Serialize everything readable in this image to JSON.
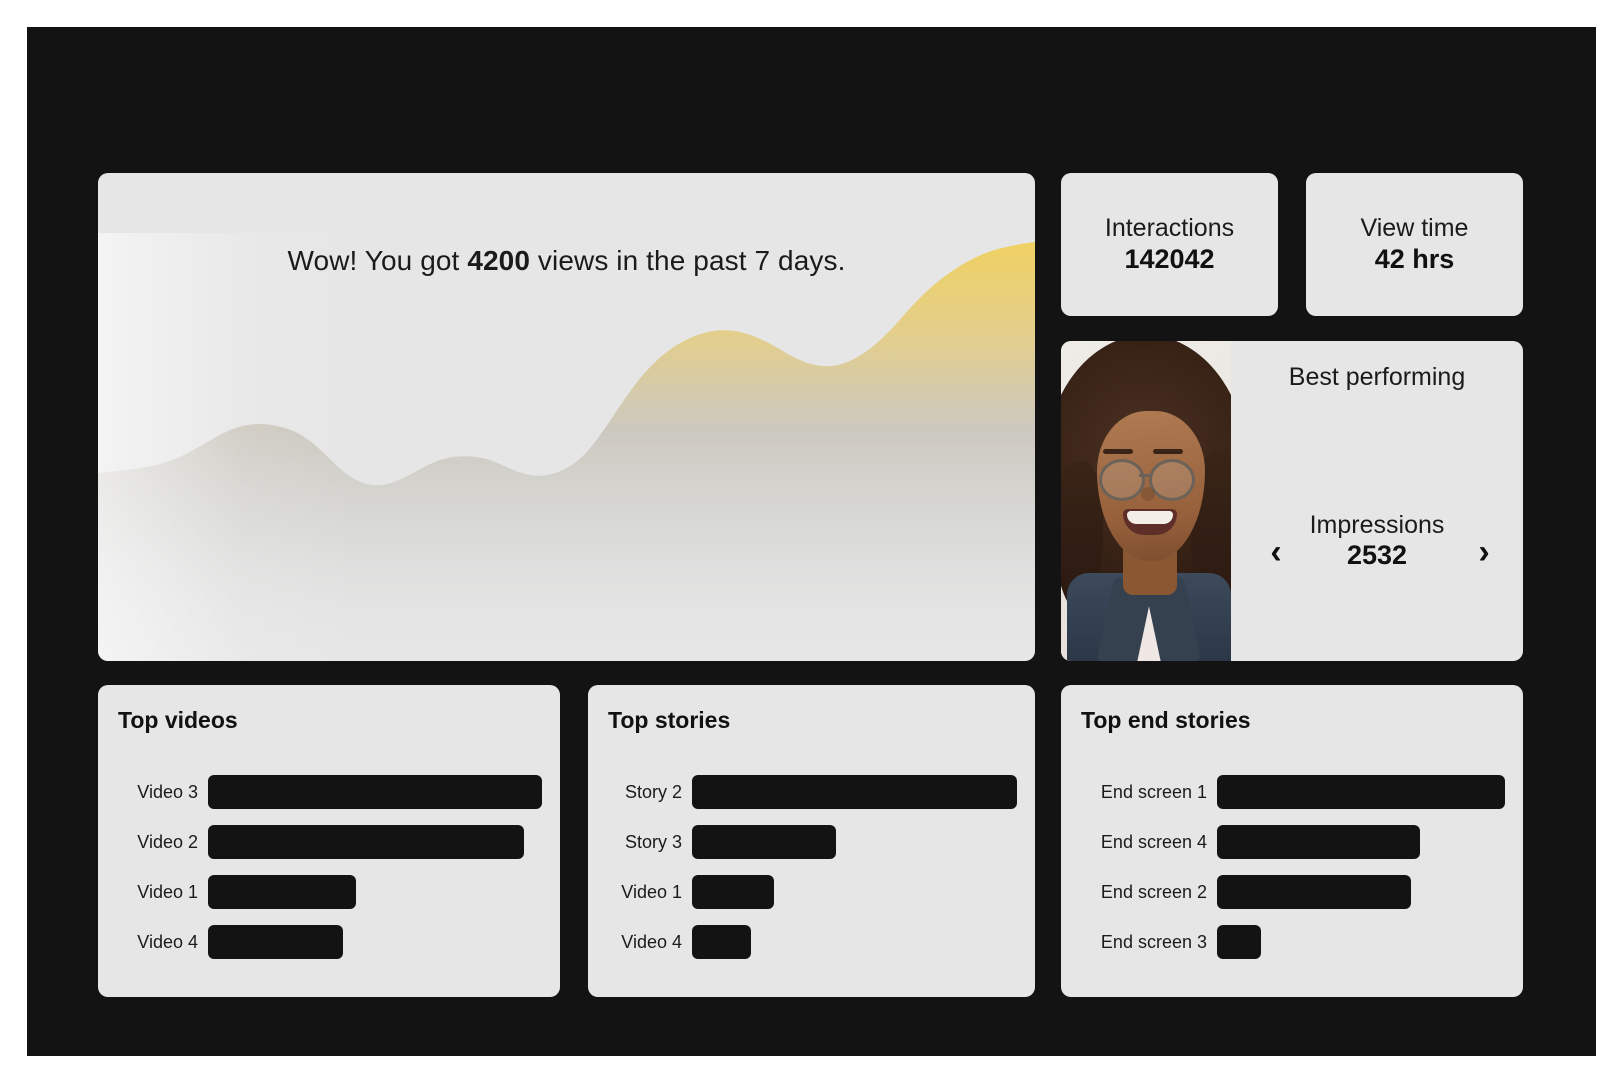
{
  "theme": {
    "canvas_bg": "#131313",
    "card_bg": "#e6e6e6",
    "text": "#1b1b1b",
    "bar": "#131313",
    "accent_yellow": "#f0d163"
  },
  "hero": {
    "headline_prefix": "Wow! You got ",
    "headline_value": "4200",
    "headline_suffix": " views in the past 7 days."
  },
  "stats": [
    {
      "name": "interactions",
      "label": "Interactions",
      "value": "142042"
    },
    {
      "name": "view-time",
      "label": "View time",
      "value": "42 hrs"
    }
  ],
  "best_performing": {
    "title": "Best performing",
    "metric_label": "Impressions",
    "metric_value": "2532",
    "prev_icon": "chevron-left-icon",
    "next_icon": "chevron-right-icon",
    "prev_glyph": "‹",
    "next_glyph": "›",
    "thumbnail_alt": "Smiling person with curly hair and round glasses wearing a denim jacket"
  },
  "panels": [
    {
      "name": "top-videos",
      "title": "Top videos",
      "rows": [
        {
          "label": "Video 3",
          "pct": 100
        },
        {
          "label": "Video 2",
          "pct": 94.7
        },
        {
          "label": "Video 1",
          "pct": 44.4
        },
        {
          "label": "Video 4",
          "pct": 40.4
        }
      ]
    },
    {
      "name": "top-stories",
      "title": "Top stories",
      "rows": [
        {
          "label": "Story 2",
          "pct": 100
        },
        {
          "label": "Story 3",
          "pct": 44.2
        },
        {
          "label": "Video 1",
          "pct": 25.1
        },
        {
          "label": "Video 4",
          "pct": 18.2
        }
      ]
    },
    {
      "name": "top-end-stories",
      "title": "Top end stories",
      "rows": [
        {
          "label": "End screen 1",
          "pct": 100
        },
        {
          "label": "End screen 4",
          "pct": 70.6
        },
        {
          "label": "End screen 2",
          "pct": 67.4
        },
        {
          "label": "End screen 3",
          "pct": 15.4
        }
      ]
    }
  ],
  "chart_data": {
    "type": "area",
    "title": "Views in the past 7 days",
    "xlabel": "",
    "ylabel": "Views",
    "grid": false,
    "legend": "none",
    "total_views": 4200,
    "x": [
      0,
      1,
      2,
      3,
      4,
      5,
      6,
      7,
      8,
      9,
      10,
      11,
      12,
      13,
      14,
      15,
      16
    ],
    "values": [
      18,
      19,
      26,
      40,
      44,
      42,
      32,
      28,
      36,
      43,
      42,
      45,
      62,
      76,
      74,
      68,
      86
    ],
    "ylim": [
      0,
      100
    ],
    "fill_top_color": "#f0d163",
    "fill_bottom_color": "#e6e6e6",
    "series": [
      {
        "name": "Views",
        "values": [
          18,
          19,
          26,
          40,
          44,
          42,
          32,
          28,
          36,
          43,
          42,
          45,
          62,
          76,
          74,
          68,
          86
        ]
      }
    ]
  }
}
